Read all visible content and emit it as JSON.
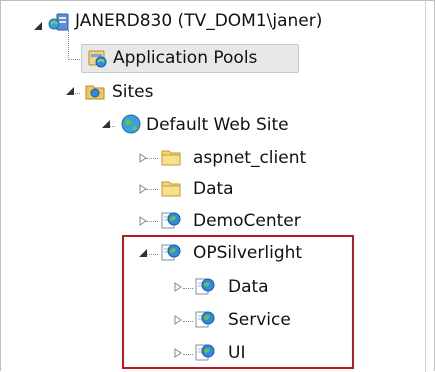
{
  "tree": {
    "items": [
      {
        "label": "JANERD830 (TV_DOM1\\janer)",
        "icon": "server-icon",
        "expanded": true
      },
      {
        "label": "Application Pools",
        "icon": "app-pool-icon",
        "selected": true
      },
      {
        "label": "Sites",
        "icon": "sites-folder-icon",
        "expanded": true
      },
      {
        "label": "Default Web Site",
        "icon": "globe-icon",
        "expanded": true
      },
      {
        "label": "aspnet_client",
        "icon": "folder-icon",
        "expanded": false
      },
      {
        "label": "Data",
        "icon": "folder-icon",
        "expanded": false
      },
      {
        "label": "DemoCenter",
        "icon": "web-app-icon",
        "expanded": false
      },
      {
        "label": "OPSilverlight",
        "icon": "web-app-icon",
        "expanded": true
      },
      {
        "label": "Data",
        "icon": "web-app-icon",
        "expanded": false
      },
      {
        "label": "Service",
        "icon": "web-app-icon",
        "expanded": false
      },
      {
        "label": "UI",
        "icon": "web-app-icon",
        "expanded": false
      }
    ]
  },
  "highlight_color": "#b71c1c"
}
